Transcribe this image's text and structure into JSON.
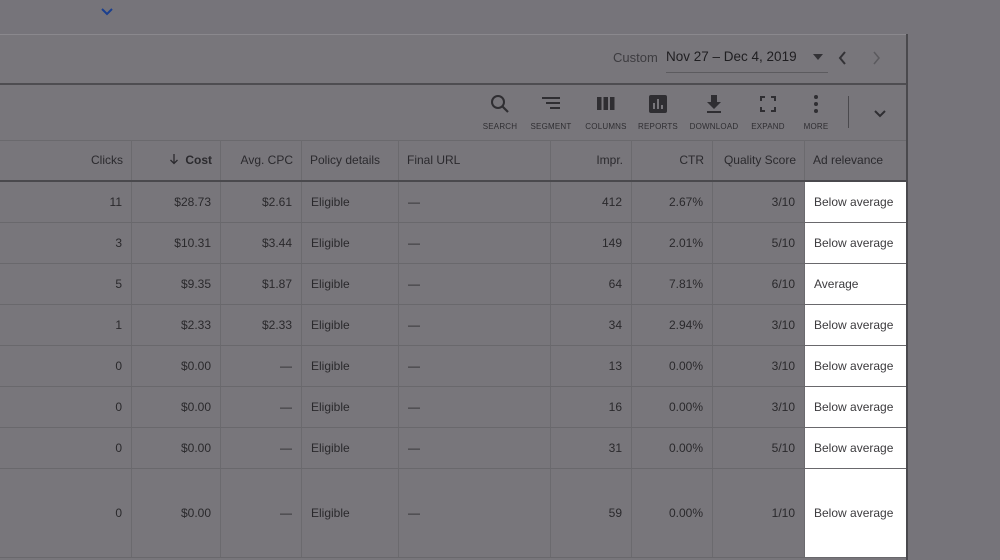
{
  "date": {
    "label": "Custom",
    "range": "Nov 27 – Dec 4, 2019"
  },
  "toolbar": [
    {
      "id": "search",
      "label": "SEARCH",
      "icon": "search-icon"
    },
    {
      "id": "segment",
      "label": "SEGMENT",
      "icon": "segment-icon"
    },
    {
      "id": "columns",
      "label": "COLUMNS",
      "icon": "columns-icon"
    },
    {
      "id": "reports",
      "label": "REPORTS",
      "icon": "reports-icon"
    },
    {
      "id": "download",
      "label": "DOWNLOAD",
      "icon": "download-icon"
    },
    {
      "id": "expand",
      "label": "EXPAND",
      "icon": "expand-icon"
    },
    {
      "id": "more",
      "label": "MORE",
      "icon": "more-vertical-icon"
    }
  ],
  "table": {
    "headers": {
      "clicks": "Clicks",
      "cost": "Cost",
      "avg_cpc": "Avg. CPC",
      "policy": "Policy details",
      "final_url": "Final URL",
      "impr": "Impr.",
      "ctr": "CTR",
      "quality": "Quality Score",
      "relevance": "Ad relevance"
    },
    "rows": [
      {
        "clicks": "11",
        "cost": "$28.73",
        "avg_cpc": "$2.61",
        "policy": "Eligible",
        "final_url": "—",
        "impr": "412",
        "ctr": "2.67%",
        "quality": "3/10",
        "relevance": "Below average"
      },
      {
        "clicks": "3",
        "cost": "$10.31",
        "avg_cpc": "$3.44",
        "policy": "Eligible",
        "final_url": "—",
        "impr": "149",
        "ctr": "2.01%",
        "quality": "5/10",
        "relevance": "Below average"
      },
      {
        "clicks": "5",
        "cost": "$9.35",
        "avg_cpc": "$1.87",
        "policy": "Eligible",
        "final_url": "—",
        "impr": "64",
        "ctr": "7.81%",
        "quality": "6/10",
        "relevance": "Average"
      },
      {
        "clicks": "1",
        "cost": "$2.33",
        "avg_cpc": "$2.33",
        "policy": "Eligible",
        "final_url": "—",
        "impr": "34",
        "ctr": "2.94%",
        "quality": "3/10",
        "relevance": "Below average"
      },
      {
        "clicks": "0",
        "cost": "$0.00",
        "avg_cpc": "—",
        "policy": "Eligible",
        "final_url": "—",
        "impr": "13",
        "ctr": "0.00%",
        "quality": "3/10",
        "relevance": "Below average"
      },
      {
        "clicks": "0",
        "cost": "$0.00",
        "avg_cpc": "—",
        "policy": "Eligible",
        "final_url": "—",
        "impr": "16",
        "ctr": "0.00%",
        "quality": "3/10",
        "relevance": "Below average"
      },
      {
        "clicks": "0",
        "cost": "$0.00",
        "avg_cpc": "—",
        "policy": "Eligible",
        "final_url": "—",
        "impr": "31",
        "ctr": "0.00%",
        "quality": "5/10",
        "relevance": "Below average"
      },
      {
        "clicks": "0",
        "cost": "$0.00",
        "avg_cpc": "—",
        "policy": "Eligible",
        "final_url": "—",
        "impr": "59",
        "ctr": "0.00%",
        "quality": "1/10",
        "relevance": "Below average"
      }
    ]
  },
  "colors": {
    "overlay": "#76747a",
    "highlight": "#ffffff",
    "accent": "#1a3f8f"
  }
}
